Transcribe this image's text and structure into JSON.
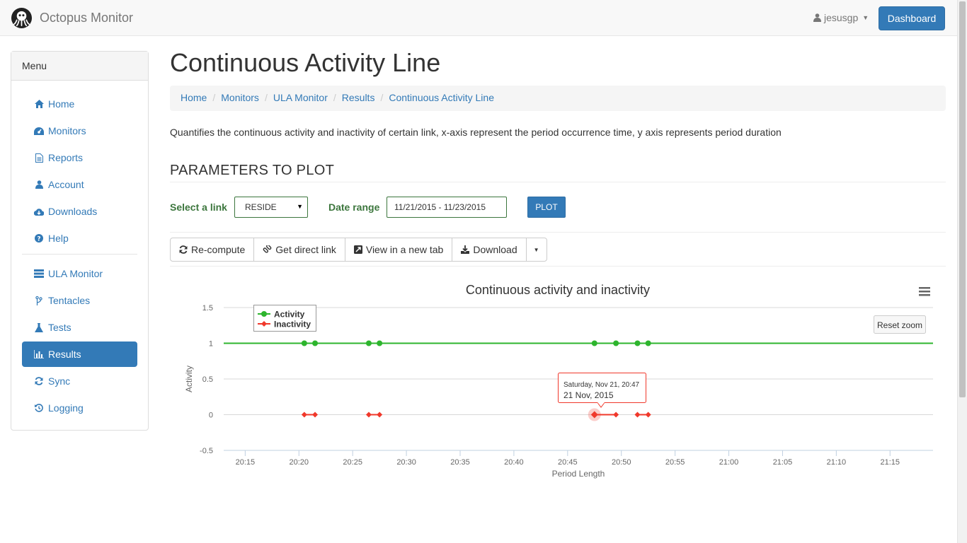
{
  "navbar": {
    "brand": "Octopus Monitor",
    "user": "jesusgp",
    "dashboard_label": "Dashboard"
  },
  "sidebar": {
    "title": "Menu",
    "items": [
      {
        "label": "Home",
        "icon": "home-icon"
      },
      {
        "label": "Monitors",
        "icon": "dashboard-icon"
      },
      {
        "label": "Reports",
        "icon": "file-icon"
      },
      {
        "label": "Account",
        "icon": "user-icon"
      },
      {
        "label": "Downloads",
        "icon": "cloud-download-icon"
      },
      {
        "label": "Help",
        "icon": "question-icon"
      },
      {
        "label": "ULA Monitor",
        "icon": "server-icon"
      },
      {
        "label": "Tentacles",
        "icon": "branch-icon"
      },
      {
        "label": "Tests",
        "icon": "flask-icon"
      },
      {
        "label": "Results",
        "icon": "bar-chart-icon",
        "active": true
      },
      {
        "label": "Sync",
        "icon": "refresh-icon"
      },
      {
        "label": "Logging",
        "icon": "history-icon"
      }
    ]
  },
  "page": {
    "title": "Continuous Activity Line",
    "breadcrumb": [
      "Home",
      "Monitors",
      "ULA Monitor",
      "Results",
      "Continuous Activity Line"
    ],
    "description": "Quantifies the continuous activity and inactivity of certain link, x-axis represent the period occurrence time, y axis represents period duration",
    "section_title": "PARAMETERS TO PLOT"
  },
  "form": {
    "link_label": "Select a link",
    "link_value": "RESIDE",
    "date_label": "Date range",
    "date_value": "11/21/2015 - 11/23/2015",
    "plot_label": "PLOT"
  },
  "toolbar": {
    "recompute": "Re-compute",
    "direct_link": "Get direct link",
    "new_tab": "View in a new tab",
    "download": "Download"
  },
  "chart_ui": {
    "reset_zoom": "Reset zoom",
    "tooltip_line1": "Saturday, Nov 21, 20:47",
    "tooltip_line2": "21 Nov, 2015"
  },
  "colors": {
    "accent": "#337ab7",
    "activity": "#2db52d",
    "inactivity": "#f0382b"
  },
  "chart_data": {
    "type": "line",
    "title": "Continuous activity and inactivity",
    "xlabel": "Period Length",
    "ylabel": "Activity",
    "x_ticks": [
      "20:15",
      "20:20",
      "20:25",
      "20:30",
      "20:35",
      "20:40",
      "20:45",
      "20:50",
      "20:55",
      "21:00",
      "21:05",
      "21:10",
      "21:15"
    ],
    "y_ticks": [
      "-0.5",
      "0",
      "0.5",
      "1",
      "1.5"
    ],
    "xlim": [
      "20:13",
      "21:19"
    ],
    "ylim": [
      -0.5,
      1.5
    ],
    "legend_position": "top-left",
    "series": [
      {
        "name": "Activity",
        "color": "#2db52d",
        "marker": "circle",
        "continuous": true,
        "line_x": [
          "20:13",
          "21:19"
        ],
        "points": [
          {
            "x": "20:20.5",
            "y": 1
          },
          {
            "x": "20:21.5",
            "y": 1
          },
          {
            "x": "20:26.5",
            "y": 1
          },
          {
            "x": "20:27.5",
            "y": 1
          },
          {
            "x": "20:47.5",
            "y": 1
          },
          {
            "x": "20:49.5",
            "y": 1
          },
          {
            "x": "20:51.5",
            "y": 1
          },
          {
            "x": "20:52.5",
            "y": 1
          }
        ]
      },
      {
        "name": "Inactivity",
        "color": "#f0382b",
        "marker": "diamond",
        "segments": [
          [
            {
              "x": "20:20.5",
              "y": 0
            },
            {
              "x": "20:21.5",
              "y": 0
            }
          ],
          [
            {
              "x": "20:26.5",
              "y": 0
            },
            {
              "x": "20:27.5",
              "y": 0
            }
          ],
          [
            {
              "x": "20:47.5",
              "y": 0
            },
            {
              "x": "20:49.5",
              "y": 0
            }
          ],
          [
            {
              "x": "20:51.5",
              "y": 0
            },
            {
              "x": "20:52.5",
              "y": 0
            }
          ]
        ],
        "highlighted": {
          "x": "20:47.5",
          "y": 0
        }
      }
    ]
  }
}
